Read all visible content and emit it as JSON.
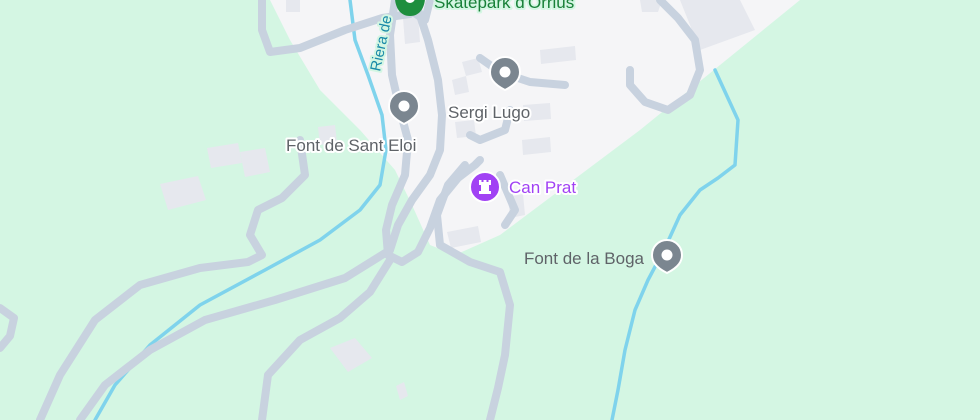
{
  "map": {
    "colors": {
      "land": "#d4f6e3",
      "urban": "#f5f5f7",
      "road": "#c8d2df",
      "water": "#7fd3ec",
      "building": "#e6e8ee",
      "pin_gray": "#7b8690",
      "pin_purple": "#a142f4",
      "pin_green": "#1e8e3e"
    },
    "places": [
      {
        "id": "skatepark",
        "label": "Skatepark d'Orrius",
        "icon": "map-pin-icon",
        "color": "green"
      },
      {
        "id": "sergi-lugo",
        "label": "Sergi Lugo",
        "icon": "map-pin-icon",
        "color": "gray"
      },
      {
        "id": "font-sant-eloi",
        "label": "Font de Sant Eloi",
        "icon": "map-pin-icon",
        "color": "gray"
      },
      {
        "id": "can-prat",
        "label": "Can Prat",
        "icon": "castle-icon",
        "color": "purple"
      },
      {
        "id": "font-boga",
        "label": "Font de la Boga",
        "icon": "map-pin-icon",
        "color": "gray"
      }
    ],
    "waterways": [
      {
        "id": "riera",
        "label": "Riera de"
      }
    ]
  }
}
